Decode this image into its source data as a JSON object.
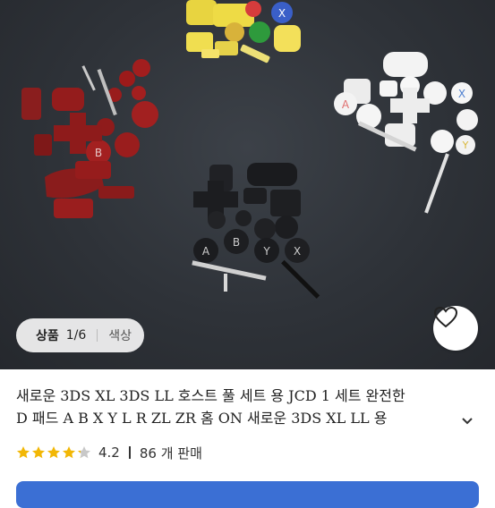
{
  "gallery": {
    "label": "상품",
    "counter": "1/6",
    "option": "색상"
  },
  "product": {
    "title_line1": "새로운 3DS XL 3DS LL 호스트 풀 세트 용 JCD 1 세트 완전한",
    "title_line2": "D 패드 A B X Y L R ZL ZR 홈 ON 새로운 3DS XL LL 용"
  },
  "rating": {
    "score": "4.2",
    "value": 4.2,
    "max": 5,
    "sold": "86 개 판매"
  },
  "icons": {
    "favorite": "heart-icon",
    "expand": "chevron-down-icon",
    "star": "star-icon"
  },
  "colors": {
    "star_fill": "#f2b705",
    "star_empty": "#c8c8c8",
    "cta": "#3b6fd4"
  }
}
